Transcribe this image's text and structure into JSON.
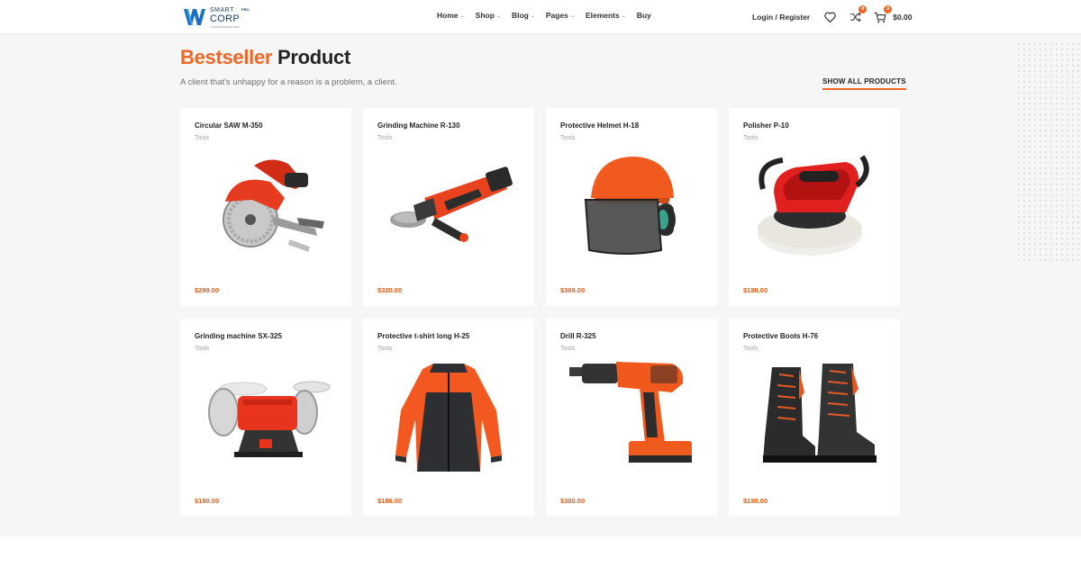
{
  "header": {
    "logo": {
      "line1": "SMART",
      "line2": "CORP",
      "badge": "PRO",
      "tagline": "YOUR BUSINESS NOW"
    },
    "nav": [
      {
        "label": "Home",
        "dropdown": true
      },
      {
        "label": "Shop",
        "dropdown": true
      },
      {
        "label": "Blog",
        "dropdown": true
      },
      {
        "label": "Pages",
        "dropdown": true
      },
      {
        "label": "Elements",
        "dropdown": true
      },
      {
        "label": "Buy",
        "dropdown": false
      }
    ],
    "login_label": "Login / Register",
    "icons": [
      "heart-icon",
      "compare-icon",
      "cart-icon"
    ],
    "compare_count": "0",
    "cart_count": "0",
    "cart_total": "$0.00"
  },
  "section": {
    "title_accent": "Bestseller",
    "title_rest": "Product",
    "subtitle": "A client that's unhappy for a reason is a problem, a client.",
    "show_all_label": "SHOW ALL PRODUCTS"
  },
  "products": [
    {
      "name": "Circular SAW M-350",
      "category": "Tools",
      "price": "$299.00",
      "icon": "circular-saw-icon"
    },
    {
      "name": "Grinding Machine R-130",
      "category": "Tools",
      "price": "$320.00",
      "icon": "angle-grinder-icon"
    },
    {
      "name": "Protective Helmet H-18",
      "category": "Tools",
      "price": "$369.00",
      "icon": "helmet-icon"
    },
    {
      "name": "Polisher P-10",
      "category": "Tools",
      "price": "$198.00",
      "icon": "polisher-icon"
    },
    {
      "name": "Grinding machine SX-325",
      "category": "Tools",
      "price": "$180.00",
      "icon": "bench-grinder-icon"
    },
    {
      "name": "Protective t-shirt long H-25",
      "category": "Tools",
      "price": "$186.00",
      "icon": "jacket-icon"
    },
    {
      "name": "Drill R-325",
      "category": "Tools",
      "price": "$300.00",
      "icon": "drill-icon"
    },
    {
      "name": "Protective Boots H-76",
      "category": "Tools",
      "price": "$199.00",
      "icon": "boots-icon"
    }
  ],
  "colors": {
    "accent": "#f26522",
    "price": "#e25a14",
    "background": "#f6f6f6",
    "logo_blue": "#1d6fc4"
  }
}
